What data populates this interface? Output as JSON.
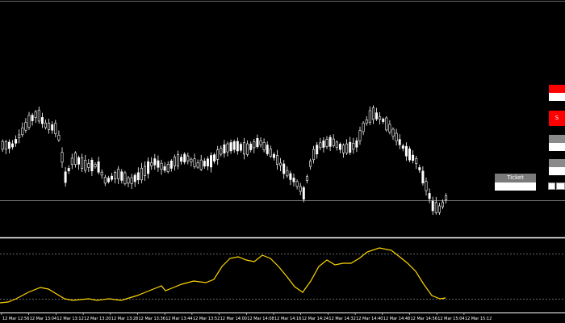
{
  "colors": {
    "background": "#000000",
    "bull_candle": "#ffffff",
    "bear_candle": "#000000",
    "candle_wick": "#ffffff",
    "oscillator_line": "#ffd700",
    "level_line": "#777777",
    "separator": "#ffffff",
    "button_red": "#ff0000",
    "button_gray": "#8a8a8a"
  },
  "panel": {
    "ticket_label": "Ticket",
    "red_button_label": "S"
  },
  "time_axis": {
    "labels": [
      "12 Mar 12:56",
      "12 Mar 13:04",
      "12 Mar 13:12",
      "12 Mar 13:20",
      "12 Mar 13:28",
      "12 Mar 13:36",
      "12 Mar 13:44",
      "12 Mar 13:52",
      "12 Mar 14:00",
      "12 Mar 14:08",
      "12 Mar 14:16",
      "12 Mar 14:24",
      "12 Mar 14:32",
      "12 Mar 14:40",
      "12 Mar 14:48",
      "12 Mar 14:56",
      "12 Mar 15:04",
      "12 Mar 15:12"
    ]
  },
  "icons": {
    "chart_window": "candlestick-chart-icon"
  }
}
